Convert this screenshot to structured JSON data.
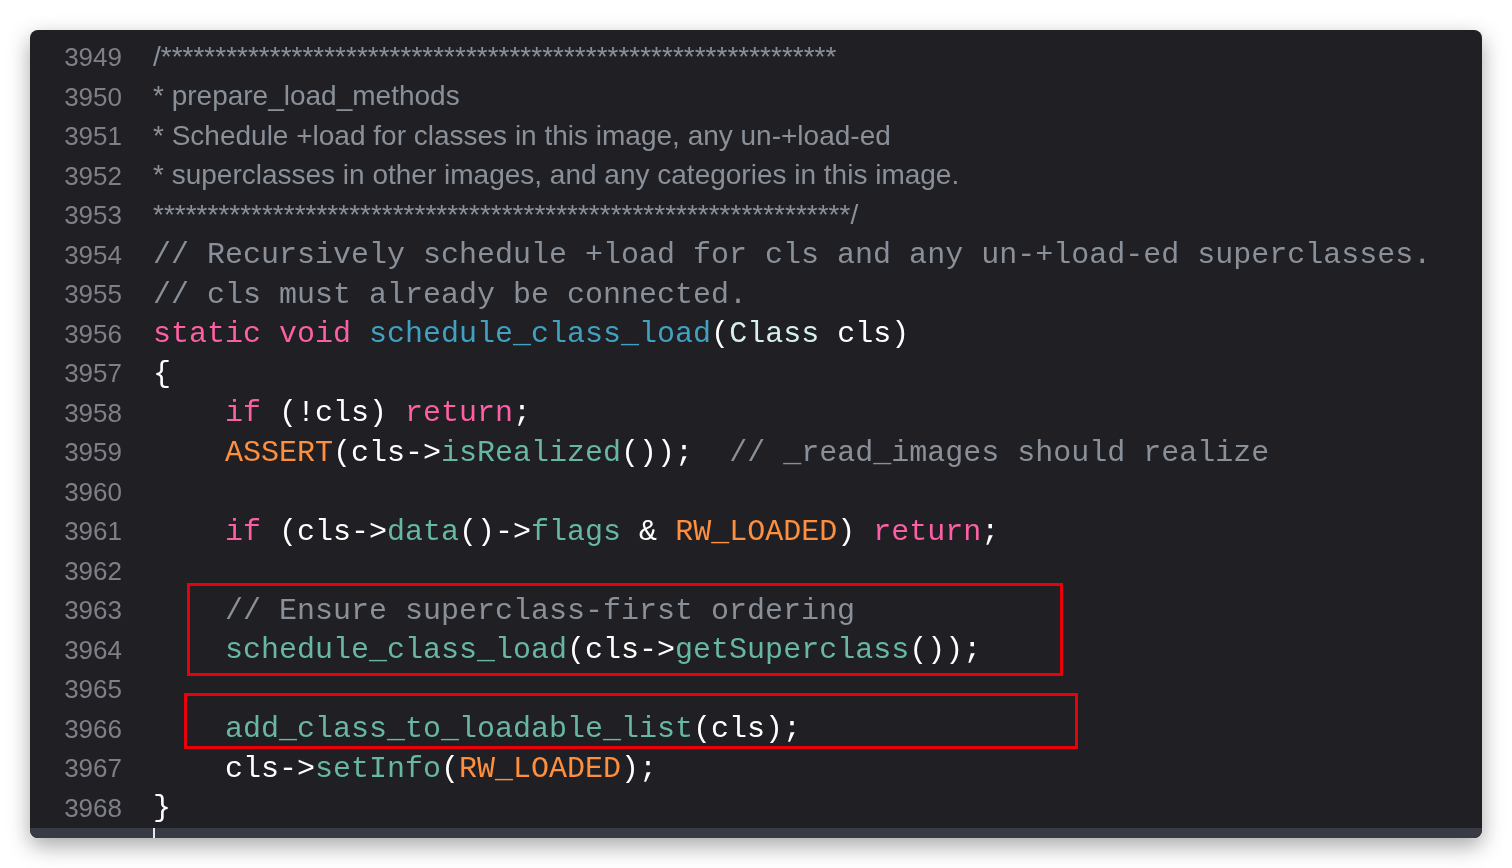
{
  "editor": {
    "blocks": [
      {
        "kind": "line",
        "number": "3949",
        "tokens": [
          {
            "kind": "doc",
            "text": "/**************************************************************"
          }
        ]
      },
      {
        "kind": "line",
        "number": "3950",
        "tokens": [
          {
            "kind": "doc",
            "text": "* prepare_load_methods"
          }
        ]
      },
      {
        "kind": "line",
        "number": "3951",
        "tokens": [
          {
            "kind": "doc",
            "text": "* Schedule +load for classes in this image, any un-+load-ed"
          }
        ]
      },
      {
        "kind": "line",
        "number": "3952",
        "tokens": [
          {
            "kind": "doc",
            "text": "* superclasses in other images, and any categories in this image."
          }
        ]
      },
      {
        "kind": "line",
        "number": "3953",
        "tokens": [
          {
            "kind": "doc",
            "text": "****************************************************************/"
          }
        ]
      },
      {
        "kind": "line",
        "number": "3954",
        "tokens": [
          {
            "kind": "comment",
            "text": "// Recursively schedule +load for cls and any un-+load-ed superclasses."
          }
        ]
      },
      {
        "kind": "line",
        "number": "3955",
        "tokens": [
          {
            "kind": "comment",
            "text": "// cls must already be connected."
          }
        ]
      },
      {
        "kind": "line",
        "number": "3956",
        "tokens": [
          {
            "kind": "keyword",
            "text": "static"
          },
          {
            "kind": "keyword",
            "text": " void"
          },
          {
            "kind": "decl",
            "text": " schedule_class_load"
          },
          {
            "kind": "plain",
            "text": "("
          },
          {
            "kind": "type",
            "text": "Class"
          },
          {
            "kind": "plain",
            "text": " cls)"
          }
        ]
      },
      {
        "kind": "line",
        "number": "3957",
        "tokens": [
          {
            "kind": "plain",
            "text": "{"
          }
        ]
      },
      {
        "kind": "line",
        "number": "3958",
        "tokens": [
          {
            "kind": "keyword",
            "text": "    if"
          },
          {
            "kind": "plain",
            "text": " (!cls) "
          },
          {
            "kind": "keyword",
            "text": "return"
          },
          {
            "kind": "plain",
            "text": ";"
          }
        ]
      },
      {
        "kind": "line",
        "number": "3959",
        "tokens": [
          {
            "kind": "macro",
            "text": "    ASSERT"
          },
          {
            "kind": "plain",
            "text": "(cls->"
          },
          {
            "kind": "call",
            "text": "isRealized"
          },
          {
            "kind": "plain",
            "text": "());  "
          },
          {
            "kind": "comment",
            "text": "// _read_images should realize"
          }
        ]
      },
      {
        "kind": "line",
        "number": "3960"
      },
      {
        "kind": "line",
        "number": "3961",
        "tokens": [
          {
            "kind": "keyword",
            "text": "    if"
          },
          {
            "kind": "plain",
            "text": " (cls->"
          },
          {
            "kind": "call",
            "text": "data"
          },
          {
            "kind": "plain",
            "text": "()->"
          },
          {
            "kind": "call",
            "text": "flags"
          },
          {
            "kind": "plain",
            "text": " & "
          },
          {
            "kind": "macro",
            "text": "RW_LOADED"
          },
          {
            "kind": "plain",
            "text": ") "
          },
          {
            "kind": "keyword",
            "text": "return"
          },
          {
            "kind": "plain",
            "text": ";"
          }
        ]
      },
      {
        "kind": "line",
        "number": "3962"
      },
      {
        "kind": "boxed",
        "lines": [
          {
            "number": "3963",
            "tokens": [
              {
                "kind": "comment",
                "text": "    // Ensure superclass-first ordering"
              }
            ]
          },
          {
            "number": "3964",
            "tokens": [
              {
                "kind": "call",
                "text": "    schedule_class_load"
              },
              {
                "kind": "plain",
                "text": "(cls->"
              },
              {
                "kind": "call",
                "text": "getSuperclass"
              },
              {
                "kind": "plain",
                "text": "());"
              }
            ]
          }
        ]
      },
      {
        "kind": "line",
        "number": "3965"
      },
      {
        "kind": "boxed",
        "lines": [
          {
            "number": "3966",
            "tokens": [
              {
                "kind": "call",
                "text": "    add_class_to_loadable_list"
              },
              {
                "kind": "plain",
                "text": "(cls);"
              }
            ]
          }
        ]
      },
      {
        "kind": "line",
        "number": "3967",
        "tokens": [
          {
            "kind": "plain",
            "text": "    cls->"
          },
          {
            "kind": "call",
            "text": "setInfo"
          },
          {
            "kind": "plain",
            "text": "("
          },
          {
            "kind": "macro",
            "text": "RW_LOADED"
          },
          {
            "kind": "plain",
            "text": ");"
          }
        ]
      },
      {
        "kind": "line",
        "number": "3968",
        "tokens": [
          {
            "kind": "plain",
            "text": "}"
          }
        ]
      }
    ]
  }
}
